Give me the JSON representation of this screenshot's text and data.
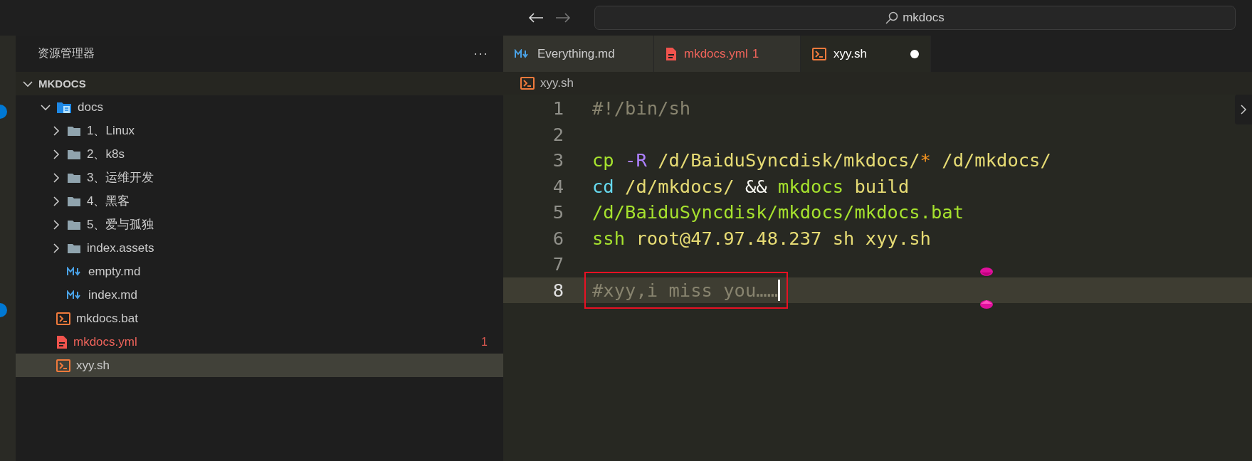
{
  "title_bar": {
    "forward_disabled": true,
    "search": {
      "value": "mkdocs"
    }
  },
  "activity_bar": {
    "badges": [
      {
        "kind": "badge"
      },
      {
        "kind": "badge"
      }
    ]
  },
  "sidebar": {
    "title": "资源管理器",
    "more": "···",
    "root": {
      "label": "MKDOCS",
      "expanded": true,
      "children": [
        {
          "label": "docs",
          "kind": "docs-folder",
          "expanded": true,
          "selected": false,
          "children": [
            {
              "label": "1、Linux",
              "kind": "folder",
              "expanded": false,
              "selected": false
            },
            {
              "label": "2、k8s",
              "kind": "folder",
              "expanded": false,
              "selected": false
            },
            {
              "label": "3、运维开发",
              "kind": "folder",
              "expanded": false,
              "selected": false
            },
            {
              "label": "4、黑客",
              "kind": "folder",
              "expanded": false,
              "selected": false
            },
            {
              "label": "5、爱与孤独",
              "kind": "folder",
              "expanded": false,
              "selected": false
            },
            {
              "label": "index.assets",
              "kind": "folder",
              "expanded": false,
              "selected": false
            },
            {
              "label": "empty.md",
              "kind": "markdown",
              "selected": false
            },
            {
              "label": "index.md",
              "kind": "markdown",
              "selected": false
            }
          ]
        },
        {
          "label": "mkdocs.bat",
          "kind": "shell",
          "selected": false
        },
        {
          "label": "mkdocs.yml",
          "kind": "yaml",
          "selected": false,
          "error": true,
          "problems": "1"
        },
        {
          "label": "xyy.sh",
          "kind": "shell",
          "selected": true
        }
      ]
    }
  },
  "tabs": [
    {
      "label": "Everything.md",
      "kind": "markdown",
      "selected": false,
      "modified": false
    },
    {
      "label": "mkdocs.yml",
      "kind": "yaml",
      "selected": false,
      "modified": false,
      "error": true,
      "problems": "1"
    },
    {
      "label": "xyy.sh",
      "kind": "shell",
      "selected": true,
      "modified": true
    }
  ],
  "breadcrumb": {
    "label": "xyy.sh",
    "kind": "shell"
  },
  "editor": {
    "lines": [
      {
        "number": "1",
        "current": false,
        "annotated": false,
        "tokens": [
          {
            "text": "#!/bin/sh",
            "kind": "comment"
          }
        ]
      },
      {
        "number": "2",
        "current": false,
        "annotated": false
      },
      {
        "number": "3",
        "current": false,
        "annotated": false,
        "tokens": [
          {
            "text": "cp",
            "kind": "command"
          },
          {
            "text": " -R",
            "kind": "flag"
          },
          {
            "text": " /d/BaiduSyncdisk/mkdocs/",
            "kind": "string"
          },
          {
            "text": "*",
            "kind": "glob"
          },
          {
            "text": " /d/mkdocs/",
            "kind": "string"
          }
        ]
      },
      {
        "number": "4",
        "current": false,
        "annotated": false,
        "tokens": [
          {
            "text": "cd",
            "kind": "builtin"
          },
          {
            "text": " /d/mkdocs/ ",
            "kind": "string"
          },
          {
            "text": "&&",
            "kind": "operator"
          },
          {
            "text": " mkdocs",
            "kind": "command"
          },
          {
            "text": " build",
            "kind": "string"
          }
        ]
      },
      {
        "number": "5",
        "current": false,
        "annotated": false,
        "tokens": [
          {
            "text": "/d/BaiduSyncdisk/mkdocs/mkdocs.bat",
            "kind": "command"
          }
        ]
      },
      {
        "number": "6",
        "current": false,
        "annotated": false,
        "tokens": [
          {
            "text": "ssh",
            "kind": "command"
          },
          {
            "text": " root@47.97.48.237 sh xyy.sh",
            "kind": "string"
          }
        ]
      },
      {
        "number": "7",
        "current": false,
        "annotated": false
      },
      {
        "number": "8",
        "current": true,
        "annotated": true,
        "tokens": [
          {
            "text": "#xyy,i miss you……",
            "kind": "comment"
          }
        ]
      }
    ]
  }
}
